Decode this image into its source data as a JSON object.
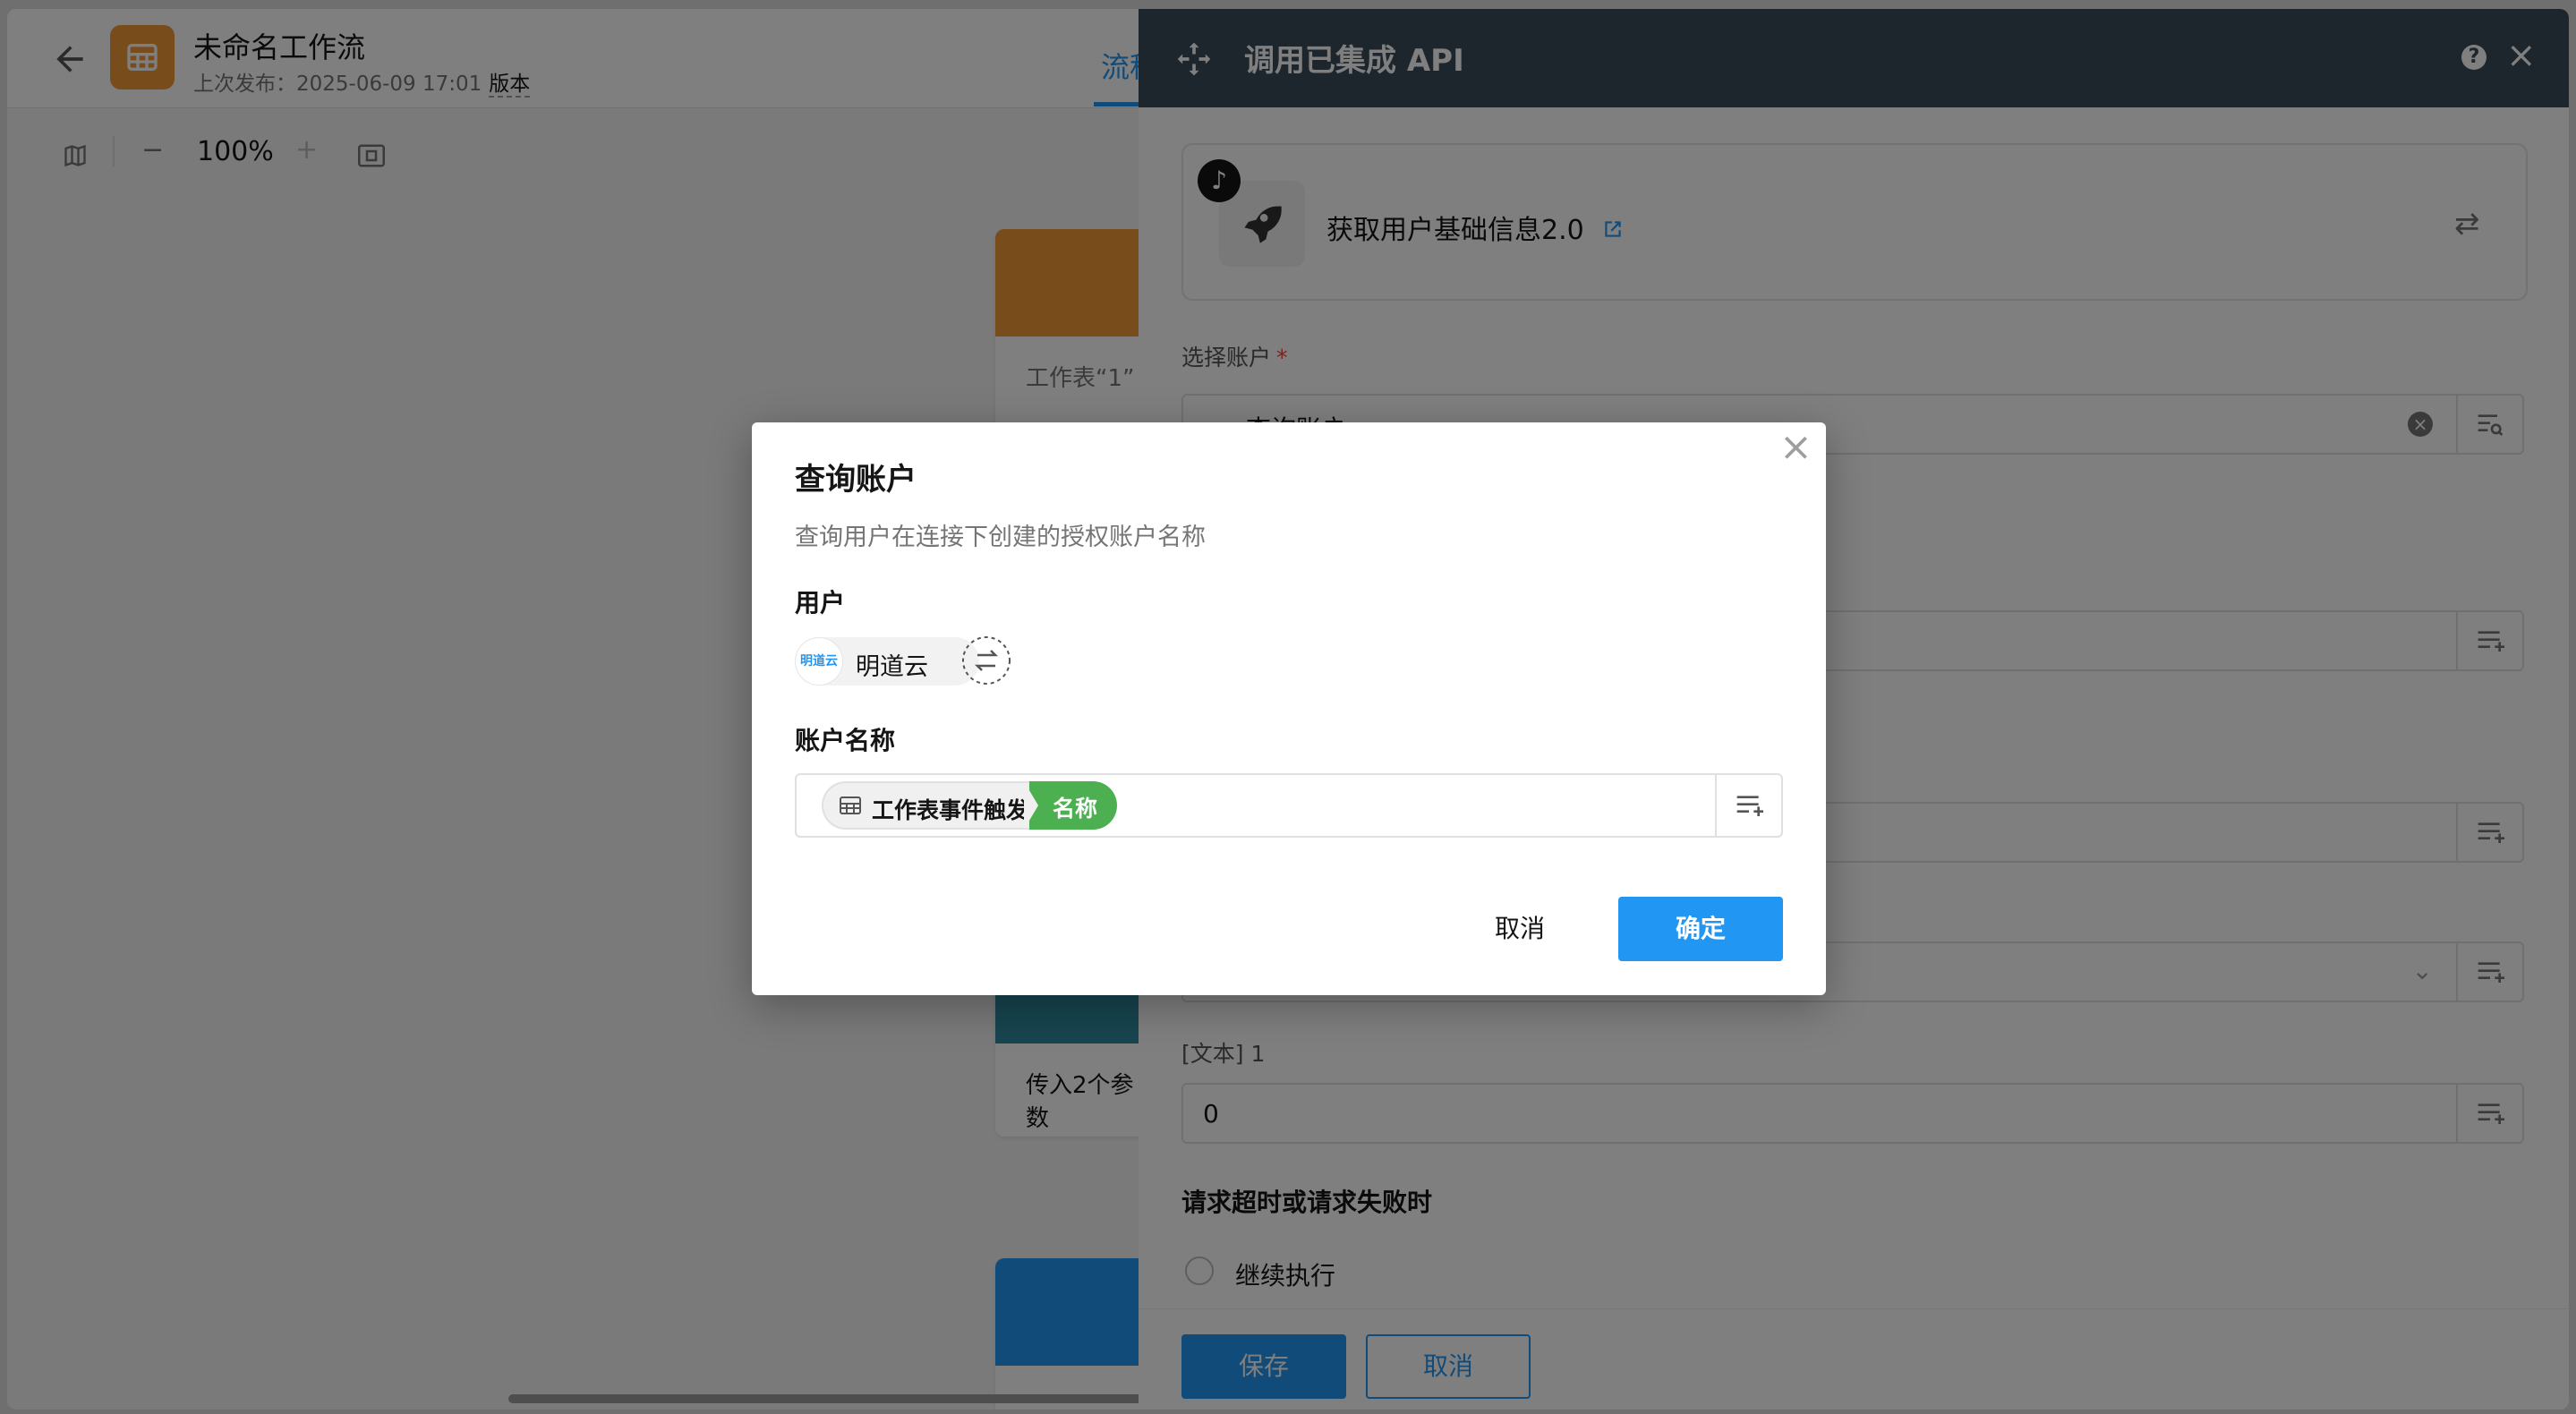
{
  "editor": {
    "workflow_title": "未命名工作流",
    "last_publish": "上次发布：2025-06-09 17:01",
    "version_link": "版本",
    "tab_flow": "流程",
    "zoom": "100%",
    "zoom_minus": "−",
    "zoom_plus": "+",
    "card_sheet_text": "工作表“1”",
    "card_params_text": "传入2个参数"
  },
  "panel": {
    "title": "调用已集成 API",
    "help": "?",
    "close": "×",
    "api_name": "获取用户基础信息2.0",
    "account_label": "选择账户",
    "account_required": "*",
    "account_value": "查询账户",
    "text_param_label": "[文本] 1",
    "text_param_value": "0",
    "timeout_title": "请求超时或请求失败时",
    "continue_label": "继续执行",
    "save_label": "保存",
    "cancel_label": "取消"
  },
  "dialog": {
    "title": "查询账户",
    "description": "查询用户在连接下创建的授权账户名称",
    "user_label": "用户",
    "user_avatar_text": "明道云",
    "user_name": "明道云",
    "account_name_label": "账户名称",
    "token_source": "工作表事件触发",
    "token_field": "名称",
    "cancel_label": "取消",
    "ok_label": "确定"
  },
  "colors": {
    "primary": "#2196f3",
    "header_dark": "#3b4a5a",
    "app_orange": "#f09a37",
    "field_green": "#4caf50"
  }
}
